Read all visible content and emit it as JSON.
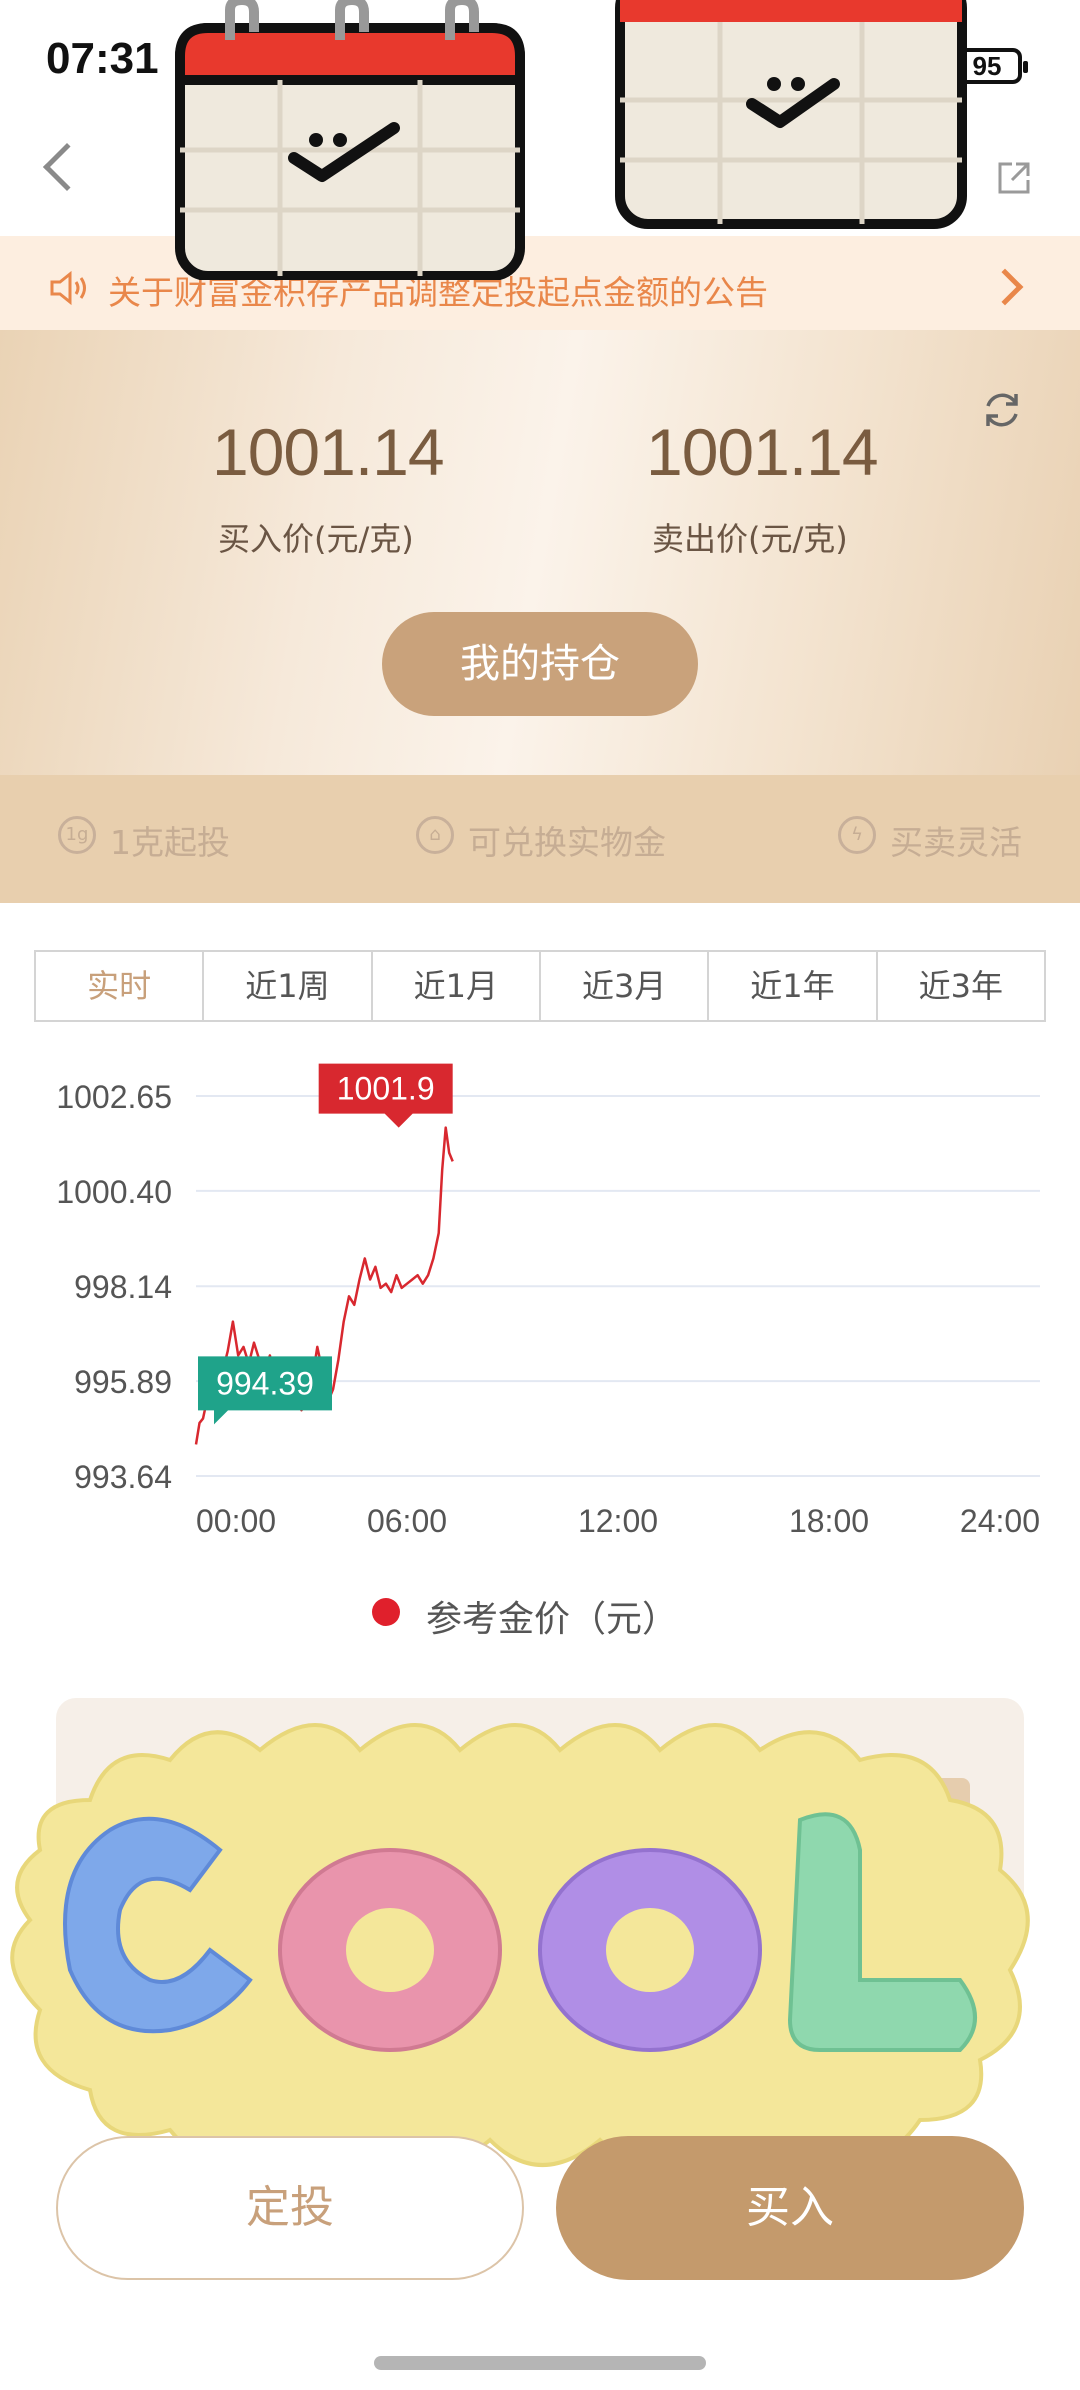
{
  "status_bar": {
    "time": "07:31",
    "battery": "95"
  },
  "notice": {
    "text": "关于财富金积存产品调整定投起点金额的公告"
  },
  "prices": {
    "buy_value": "1001.14",
    "buy_label": "买入价(元/克)",
    "sell_value": "1001.14",
    "sell_label": "卖出价(元/克)"
  },
  "holdings_button": "我的持仓",
  "features": [
    {
      "icon_text": "1g",
      "label": "1克起投"
    },
    {
      "icon_text": "",
      "label": "可兑换实物金"
    },
    {
      "icon_text": "",
      "label": "买卖灵活"
    }
  ],
  "tabs": [
    "实时",
    "近1周",
    "近1月",
    "近3月",
    "近1年",
    "近3年"
  ],
  "chart_data": {
    "type": "line",
    "title": "",
    "xlabel": "",
    "ylabel": "",
    "x_ticks": [
      "00:00",
      "06:00",
      "12:00",
      "18:00",
      "24:00"
    ],
    "y_ticks": [
      "1002.65",
      "1000.40",
      "998.14",
      "995.89",
      "993.64"
    ],
    "ylim": [
      993.64,
      1002.65
    ],
    "xlim_hours": [
      0,
      24
    ],
    "max_label": "1001.9",
    "min_label": "994.39",
    "series": [
      {
        "name": "参考金价（元）",
        "color": "#d8282f",
        "x_hours": [
          0.0,
          0.1,
          0.2,
          0.3,
          0.45,
          0.6,
          0.75,
          0.9,
          1.05,
          1.2,
          1.35,
          1.5,
          1.65,
          1.8,
          1.95,
          2.1,
          2.25,
          2.4,
          2.55,
          2.7,
          2.85,
          3.0,
          3.15,
          3.3,
          3.45,
          3.6,
          3.75,
          3.9,
          4.05,
          4.2,
          4.35,
          4.5,
          4.65,
          4.8,
          4.95,
          5.1,
          5.25,
          5.4,
          5.55,
          5.7,
          5.85,
          6.0,
          6.15,
          6.3,
          6.45,
          6.6,
          6.75,
          6.9,
          7.0,
          7.1,
          7.2,
          7.3
        ],
        "values": [
          994.39,
          994.9,
          995.0,
          995.4,
          995.9,
          996.3,
          996.1,
          996.6,
          997.3,
          996.5,
          996.7,
          996.3,
          996.8,
          996.4,
          996.1,
          996.5,
          995.9,
          996.0,
          995.6,
          995.8,
          995.4,
          995.2,
          995.6,
          995.9,
          996.7,
          996.1,
          995.4,
          995.7,
          996.4,
          997.3,
          997.9,
          997.7,
          998.3,
          998.8,
          998.3,
          998.6,
          998.1,
          998.2,
          998.0,
          998.4,
          998.1,
          998.2,
          998.3,
          998.4,
          998.2,
          998.4,
          998.8,
          999.4,
          1000.9,
          1001.9,
          1001.3,
          1001.1
        ]
      }
    ],
    "legend": "参考金价（元）"
  },
  "bottom_buttons": {
    "sip": "定投",
    "buy": "买入"
  },
  "colors": {
    "accent_gold": "#c9a27b",
    "notice_orange": "#e9874a",
    "line_red": "#d8282f",
    "min_label_green": "#1fa38a"
  }
}
